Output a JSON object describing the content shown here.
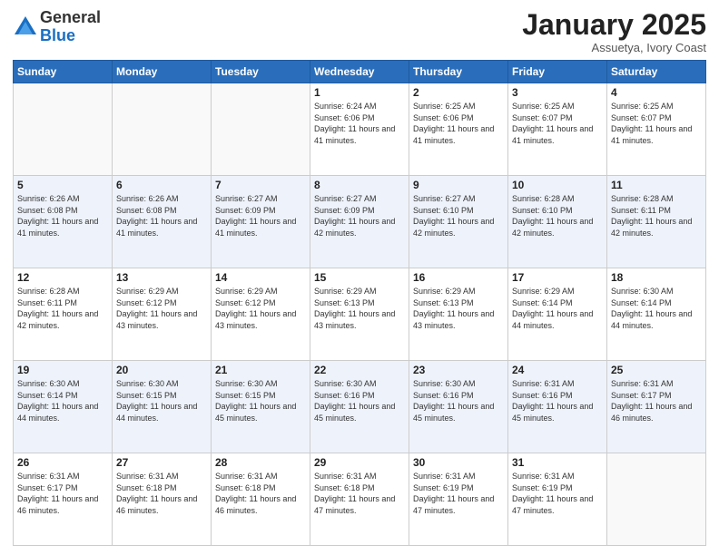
{
  "logo": {
    "general": "General",
    "blue": "Blue"
  },
  "header": {
    "month": "January 2025",
    "location": "Assuetya, Ivory Coast"
  },
  "weekdays": [
    "Sunday",
    "Monday",
    "Tuesday",
    "Wednesday",
    "Thursday",
    "Friday",
    "Saturday"
  ],
  "weeks": [
    [
      {
        "day": "",
        "empty": true
      },
      {
        "day": "",
        "empty": true
      },
      {
        "day": "",
        "empty": true
      },
      {
        "day": "1",
        "sunrise": "6:24 AM",
        "sunset": "6:06 PM",
        "daylight": "11 hours and 41 minutes."
      },
      {
        "day": "2",
        "sunrise": "6:25 AM",
        "sunset": "6:06 PM",
        "daylight": "11 hours and 41 minutes."
      },
      {
        "day": "3",
        "sunrise": "6:25 AM",
        "sunset": "6:07 PM",
        "daylight": "11 hours and 41 minutes."
      },
      {
        "day": "4",
        "sunrise": "6:25 AM",
        "sunset": "6:07 PM",
        "daylight": "11 hours and 41 minutes."
      }
    ],
    [
      {
        "day": "5",
        "sunrise": "6:26 AM",
        "sunset": "6:08 PM",
        "daylight": "11 hours and 41 minutes."
      },
      {
        "day": "6",
        "sunrise": "6:26 AM",
        "sunset": "6:08 PM",
        "daylight": "11 hours and 41 minutes."
      },
      {
        "day": "7",
        "sunrise": "6:27 AM",
        "sunset": "6:09 PM",
        "daylight": "11 hours and 41 minutes."
      },
      {
        "day": "8",
        "sunrise": "6:27 AM",
        "sunset": "6:09 PM",
        "daylight": "11 hours and 42 minutes."
      },
      {
        "day": "9",
        "sunrise": "6:27 AM",
        "sunset": "6:10 PM",
        "daylight": "11 hours and 42 minutes."
      },
      {
        "day": "10",
        "sunrise": "6:28 AM",
        "sunset": "6:10 PM",
        "daylight": "11 hours and 42 minutes."
      },
      {
        "day": "11",
        "sunrise": "6:28 AM",
        "sunset": "6:11 PM",
        "daylight": "11 hours and 42 minutes."
      }
    ],
    [
      {
        "day": "12",
        "sunrise": "6:28 AM",
        "sunset": "6:11 PM",
        "daylight": "11 hours and 42 minutes."
      },
      {
        "day": "13",
        "sunrise": "6:29 AM",
        "sunset": "6:12 PM",
        "daylight": "11 hours and 43 minutes."
      },
      {
        "day": "14",
        "sunrise": "6:29 AM",
        "sunset": "6:12 PM",
        "daylight": "11 hours and 43 minutes."
      },
      {
        "day": "15",
        "sunrise": "6:29 AM",
        "sunset": "6:13 PM",
        "daylight": "11 hours and 43 minutes."
      },
      {
        "day": "16",
        "sunrise": "6:29 AM",
        "sunset": "6:13 PM",
        "daylight": "11 hours and 43 minutes."
      },
      {
        "day": "17",
        "sunrise": "6:29 AM",
        "sunset": "6:14 PM",
        "daylight": "11 hours and 44 minutes."
      },
      {
        "day": "18",
        "sunrise": "6:30 AM",
        "sunset": "6:14 PM",
        "daylight": "11 hours and 44 minutes."
      }
    ],
    [
      {
        "day": "19",
        "sunrise": "6:30 AM",
        "sunset": "6:14 PM",
        "daylight": "11 hours and 44 minutes."
      },
      {
        "day": "20",
        "sunrise": "6:30 AM",
        "sunset": "6:15 PM",
        "daylight": "11 hours and 44 minutes."
      },
      {
        "day": "21",
        "sunrise": "6:30 AM",
        "sunset": "6:15 PM",
        "daylight": "11 hours and 45 minutes."
      },
      {
        "day": "22",
        "sunrise": "6:30 AM",
        "sunset": "6:16 PM",
        "daylight": "11 hours and 45 minutes."
      },
      {
        "day": "23",
        "sunrise": "6:30 AM",
        "sunset": "6:16 PM",
        "daylight": "11 hours and 45 minutes."
      },
      {
        "day": "24",
        "sunrise": "6:31 AM",
        "sunset": "6:16 PM",
        "daylight": "11 hours and 45 minutes."
      },
      {
        "day": "25",
        "sunrise": "6:31 AM",
        "sunset": "6:17 PM",
        "daylight": "11 hours and 46 minutes."
      }
    ],
    [
      {
        "day": "26",
        "sunrise": "6:31 AM",
        "sunset": "6:17 PM",
        "daylight": "11 hours and 46 minutes."
      },
      {
        "day": "27",
        "sunrise": "6:31 AM",
        "sunset": "6:18 PM",
        "daylight": "11 hours and 46 minutes."
      },
      {
        "day": "28",
        "sunrise": "6:31 AM",
        "sunset": "6:18 PM",
        "daylight": "11 hours and 46 minutes."
      },
      {
        "day": "29",
        "sunrise": "6:31 AM",
        "sunset": "6:18 PM",
        "daylight": "11 hours and 47 minutes."
      },
      {
        "day": "30",
        "sunrise": "6:31 AM",
        "sunset": "6:19 PM",
        "daylight": "11 hours and 47 minutes."
      },
      {
        "day": "31",
        "sunrise": "6:31 AM",
        "sunset": "6:19 PM",
        "daylight": "11 hours and 47 minutes."
      },
      {
        "day": "",
        "empty": true
      }
    ]
  ]
}
